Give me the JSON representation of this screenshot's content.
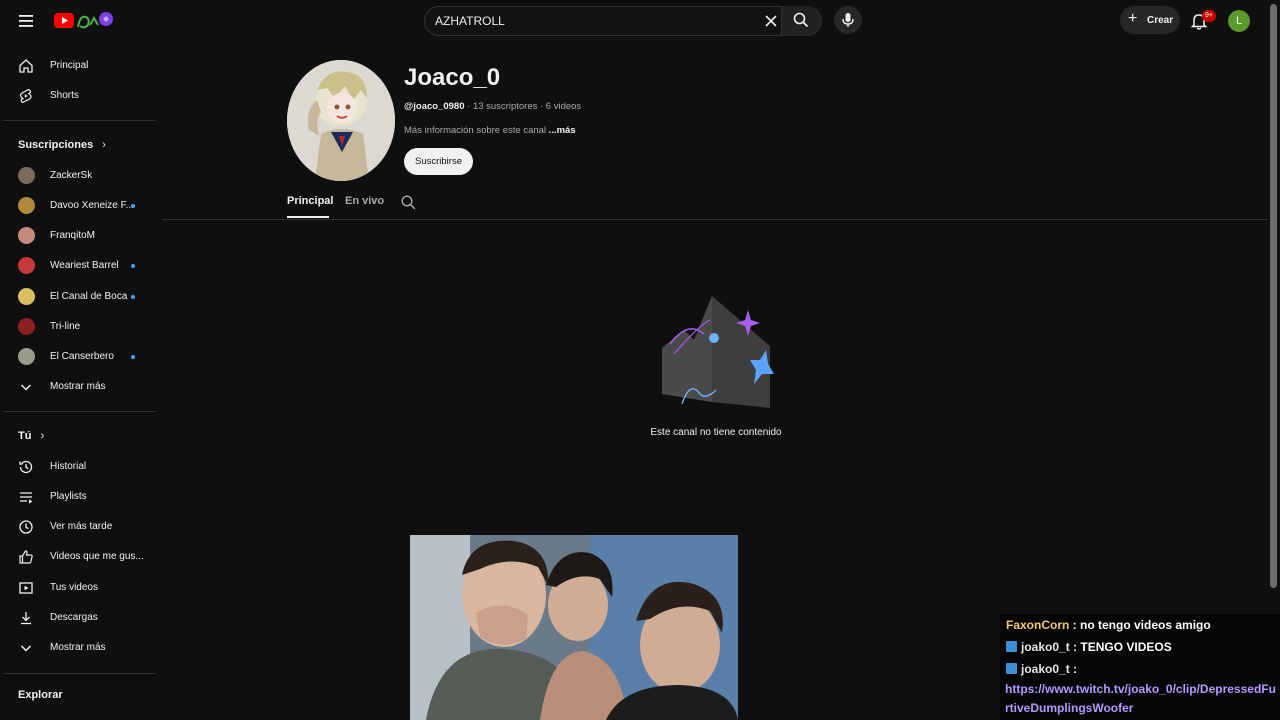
{
  "header": {
    "search_value": "AZHATROLL",
    "create_label": "Crear",
    "notification_count": "9+",
    "avatar_initial": "L"
  },
  "sidebar": {
    "main": [
      {
        "label": "Principal",
        "icon": "home-icon"
      },
      {
        "label": "Shorts",
        "icon": "shorts-icon"
      }
    ],
    "subscriptions_heading": "Suscripciones",
    "subscriptions": [
      {
        "label": "ZackerSk",
        "new": false,
        "color": "#7a6a5a"
      },
      {
        "label": "Davoo Xeneize F...",
        "new": true,
        "color": "#b08a3a"
      },
      {
        "label": "FranqitoM",
        "new": false,
        "color": "#c48a7a"
      },
      {
        "label": "Weariest Barrel",
        "new": true,
        "color": "#c43a3a"
      },
      {
        "label": "El Canal de Boca",
        "new": true,
        "color": "#d8c060"
      },
      {
        "label": "Tri-line",
        "new": false,
        "color": "#8a1f1f"
      },
      {
        "label": "El Canserbero",
        "new": true,
        "color": "#9a9a8a"
      }
    ],
    "subscriptions_more": "Mostrar más",
    "you_heading": "Tú",
    "you": [
      {
        "label": "Historial",
        "icon": "history-icon"
      },
      {
        "label": "Playlists",
        "icon": "playlists-icon"
      },
      {
        "label": "Ver más tarde",
        "icon": "watch-later-icon"
      },
      {
        "label": "Videos que me gus...",
        "icon": "like-icon"
      },
      {
        "label": "Tus videos",
        "icon": "your-videos-icon"
      },
      {
        "label": "Descargas",
        "icon": "download-icon"
      }
    ],
    "you_more": "Mostrar más",
    "explore_heading": "Explorar"
  },
  "channel": {
    "name": "Joaco_0",
    "handle": "@joaco_0980",
    "stats": " · 13 suscriptores · 6 videos",
    "more_info": "Más información sobre este canal",
    "more_link": " ...más",
    "subscribe_label": "Suscribirse",
    "tabs": [
      {
        "label": "Principal",
        "active": true
      },
      {
        "label": "En vivo",
        "active": false
      }
    ],
    "empty_message": "Este canal no tiene contenido"
  },
  "chat": [
    {
      "user": "FaxonCorn",
      "sep": " : ",
      "message": "no tengo videos amigo",
      "badge": false
    },
    {
      "user": "joako0_t",
      "sep": " : ",
      "message": "TENGO VIDEOS",
      "badge": true
    },
    {
      "user": "joako0_t",
      "sep": " :",
      "message": "",
      "badge": true
    }
  ],
  "chat_link": "https://www.twitch.tv/joako_0/clip/DepressedFurtiveDumplingsWoofer"
}
